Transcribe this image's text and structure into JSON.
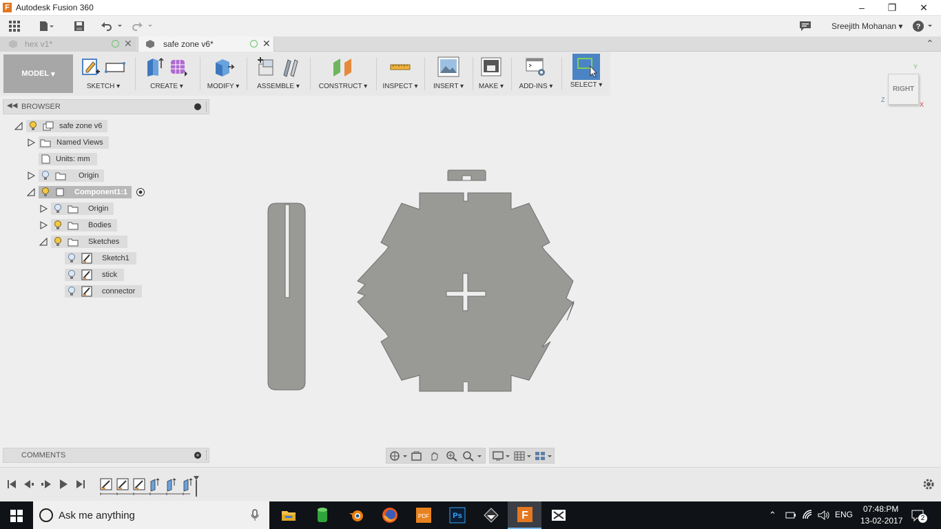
{
  "window": {
    "title": "Autodesk Fusion 360",
    "logo_letter": "F"
  },
  "user": {
    "name": "Sreejith Mohanan"
  },
  "tabs": [
    {
      "label": "hex v1*"
    },
    {
      "label": "safe zone v6*"
    }
  ],
  "toolbar": {
    "workspace": "MODEL",
    "groups": [
      {
        "label": "SKETCH"
      },
      {
        "label": "CREATE"
      },
      {
        "label": "MODIFY"
      },
      {
        "label": "ASSEMBLE"
      },
      {
        "label": "CONSTRUCT"
      },
      {
        "label": "INSPECT"
      },
      {
        "label": "INSERT"
      },
      {
        "label": "MAKE"
      },
      {
        "label": "ADD-INS"
      },
      {
        "label": "SELECT"
      }
    ]
  },
  "browser": {
    "title": "BROWSER",
    "tree": [
      {
        "label": "safe zone v6"
      },
      {
        "label": "Named Views"
      },
      {
        "label": "Units: mm"
      },
      {
        "label": "Origin"
      },
      {
        "label": "Component1:1"
      },
      {
        "label": "Origin"
      },
      {
        "label": "Bodies"
      },
      {
        "label": "Sketches"
      },
      {
        "label": "Sketch1"
      },
      {
        "label": "stick"
      },
      {
        "label": "connector"
      }
    ]
  },
  "comments": {
    "title": "COMMENTS"
  },
  "viewcube": {
    "face": "RIGHT",
    "axis_y": "Y",
    "axis_z": "Z",
    "axis_x": "X"
  },
  "taskbar": {
    "search_placeholder": "Ask me anything",
    "language": "ENG",
    "time": "07:48:PM",
    "date": "13-02-2017",
    "notifications": "2"
  },
  "colors": {
    "accent": "#4b84c4",
    "part_fill": "#999996",
    "part_stroke": "#6f6f6f",
    "taskbar": "#0f1216"
  }
}
